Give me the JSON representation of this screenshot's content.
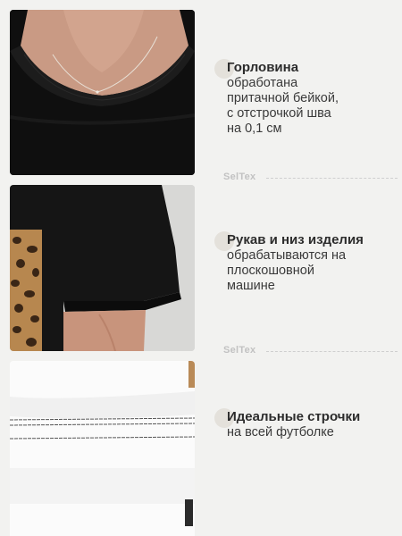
{
  "features": [
    {
      "title": "Горловина",
      "lines": [
        "обработана",
        "притачной бейкой,",
        "с отстрочкой шва",
        "на 0,1 см"
      ]
    },
    {
      "title": "Рукав и низ изделия",
      "lines": [
        "обрабатываются на",
        "плоскошовной",
        "машине"
      ]
    },
    {
      "title": "Идеальные строчки",
      "lines": [
        "на всей футболке"
      ]
    }
  ],
  "brand": {
    "name": "SelTex",
    "separators": [
      {
        "name": "SelTex"
      },
      {
        "name": "SelTex"
      }
    ]
  },
  "colors": {
    "background": "#f2f2f0",
    "accent_dot": "#e4e1db",
    "shirt": "#121212",
    "title": "#2c2c2c"
  }
}
